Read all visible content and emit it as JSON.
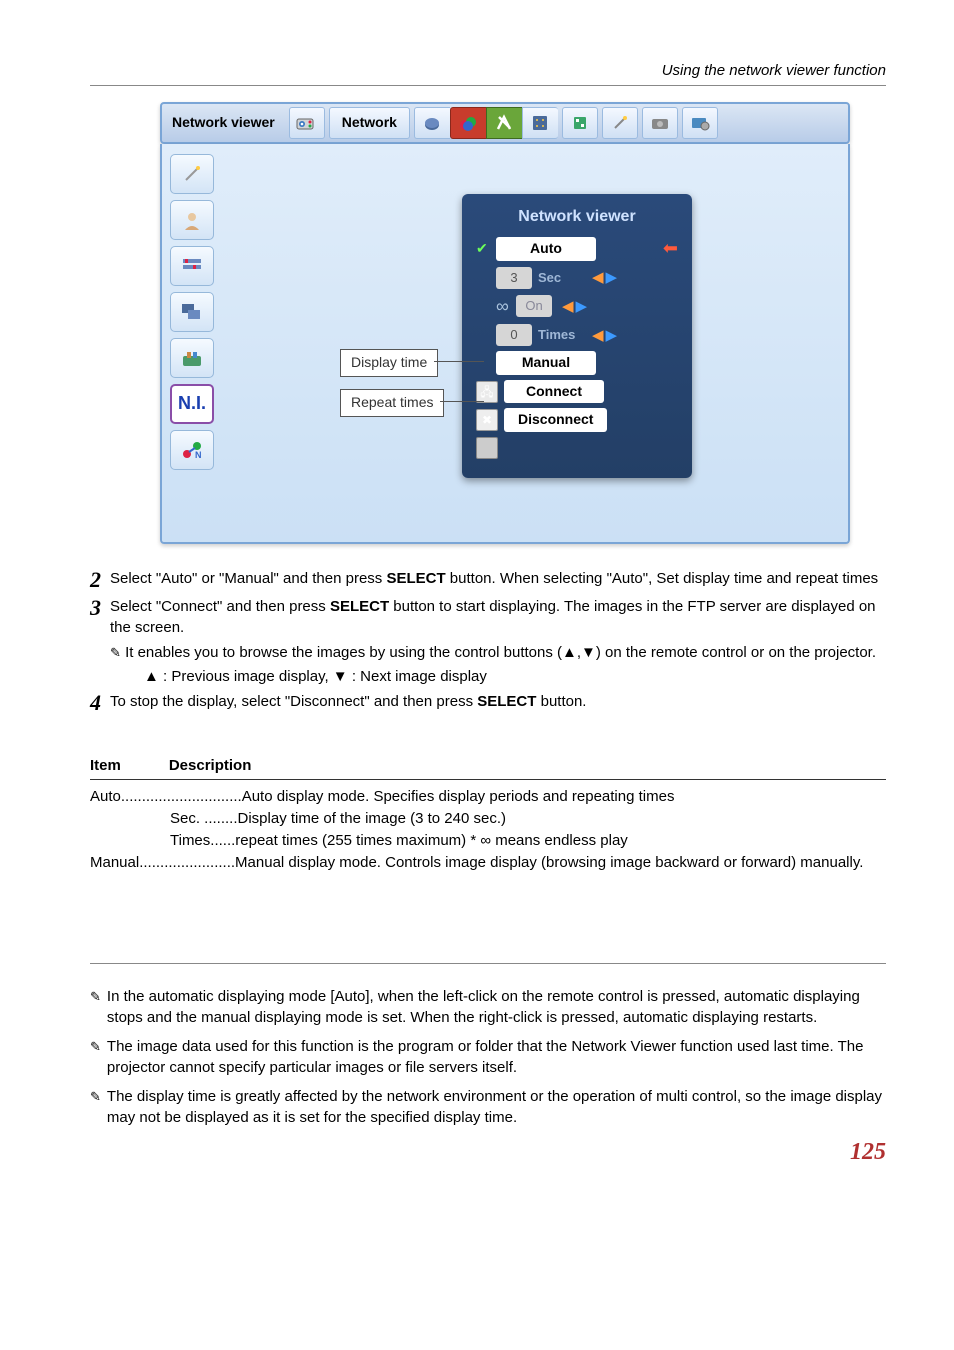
{
  "header": {
    "section_title": "Using the network viewer function"
  },
  "menubar": {
    "title": "Network viewer",
    "tab_label": "Network"
  },
  "osd": {
    "title": "Network viewer",
    "auto_label": "Auto",
    "sec_value": "3",
    "sec_label": "Sec",
    "on_label": "On",
    "times_value": "0",
    "times_label": "Times",
    "manual_label": "Manual",
    "connect_label": "Connect",
    "disconnect_label": "Disconnect"
  },
  "callouts": {
    "display_time": "Display time",
    "repeat_times": "Repeat times"
  },
  "steps": {
    "s2_num": "2",
    "s2_text_a": "Select \"Auto\" or \"Manual\" and then press ",
    "s2_bold": "SELECT",
    "s2_text_b": " button. When selecting \"Auto\", Set display time and repeat times",
    "s3_num": "3",
    "s3_text_a": "Select \"Connect\" and then press ",
    "s3_bold": "SELECT",
    "s3_text_b": " button to start displaying. The images in the FTP server are displayed on the  screen.",
    "s3_note": "It enables you to browse the images by using the control buttons (▲,▼) on the remote control or on the projector.",
    "s3_sub": "▲ : Previous image display,  ▼ : Next image display",
    "s4_num": "4",
    "s4_text_a": "To stop the display, select \"Disconnect\" and then press ",
    "s4_bold": "SELECT",
    "s4_text_b": " button."
  },
  "table": {
    "h_item": "Item",
    "h_desc": "Description",
    "r_auto": "Auto.............................Auto display mode. Specifies display periods and repeating times",
    "r_sec": "Sec.  ........Display time of the image (3 to 240 sec.)",
    "r_times": "Times......repeat times (255 times maximum) * ∞ means endless play",
    "r_manual": "Manual.......................Manual display mode. Controls image display (browsing image backward or forward) manually."
  },
  "footnotes": {
    "n1": "In the automatic displaying mode [Auto], when the left-click on the remote control is pressed, automatic displaying stops and the manual displaying mode is set. When the right-click is pressed, automatic displaying restarts.",
    "n2": "The image data used for this function is the program or folder that the Network Viewer function used last time. The projector cannot specify particular images or file servers itself.",
    "n3": "The display time is greatly affected by the network environment or the operation of multi control, so the image display may not be displayed as it is set for the specified display time."
  },
  "page_number": "125"
}
